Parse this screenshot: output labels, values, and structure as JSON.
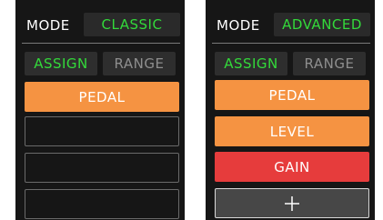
{
  "panels": [
    {
      "mode_label": "MODE",
      "mode_value": "CLASSIC",
      "tabs": [
        {
          "label": "ASSIGN",
          "active": true
        },
        {
          "label": "RANGE",
          "active": false
        }
      ],
      "slots": [
        {
          "label": "PEDAL",
          "color": "#f59342"
        },
        {
          "label": ""
        },
        {
          "label": ""
        },
        {
          "label": ""
        }
      ]
    },
    {
      "mode_label": "MODE",
      "mode_value": "ADVANCED",
      "tabs": [
        {
          "label": "ASSIGN",
          "active": true
        },
        {
          "label": "RANGE",
          "active": false
        }
      ],
      "slots": [
        {
          "label": "PEDAL",
          "color": "#f59342"
        },
        {
          "label": "LEVEL",
          "color": "#f59342"
        },
        {
          "label": "GAIN",
          "color": "#e63c3c"
        }
      ],
      "add_button_icon": "plus-icon"
    }
  ],
  "colors": {
    "panel_bg": "#161616",
    "active_green": "#33d93a",
    "inactive_gray": "#8e8e8e"
  }
}
